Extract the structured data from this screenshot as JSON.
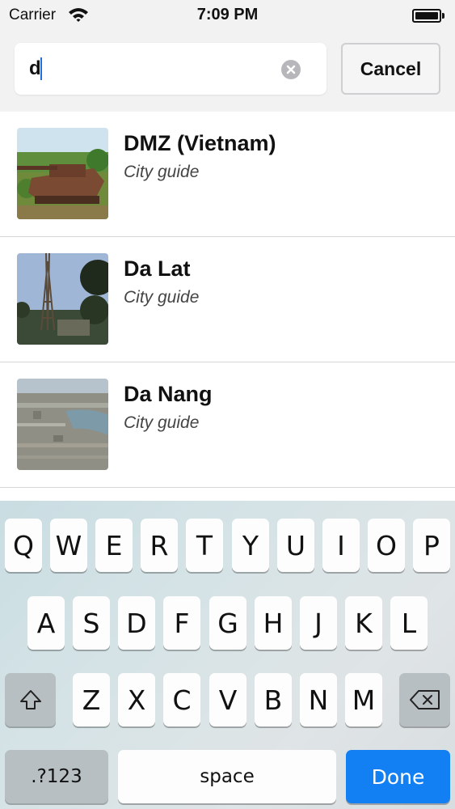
{
  "status_bar": {
    "carrier": "Carrier",
    "time": "7:09 PM",
    "wifi_icon": "wifi-icon",
    "battery_icon": "battery-icon",
    "battery_level": 1.0
  },
  "search": {
    "query": "d",
    "clear_icon": "clear-circle-icon",
    "cancel_label": "Cancel"
  },
  "results": [
    {
      "title": "DMZ (Vietnam)",
      "subtitle": "City guide",
      "thumbnail": "photo-tank"
    },
    {
      "title": "Da Lat",
      "subtitle": "City guide",
      "thumbnail": "photo-tower"
    },
    {
      "title": "Da Nang",
      "subtitle": "City guide",
      "thumbnail": "photo-city-aerial"
    }
  ],
  "keyboard": {
    "row1": [
      "Q",
      "W",
      "E",
      "R",
      "T",
      "Y",
      "U",
      "I",
      "O",
      "P"
    ],
    "row2": [
      "A",
      "S",
      "D",
      "F",
      "G",
      "H",
      "J",
      "K",
      "L"
    ],
    "row3": [
      "Z",
      "X",
      "C",
      "V",
      "B",
      "N",
      "M"
    ],
    "shift_icon": "shift-arrow-icon",
    "delete_icon": "backspace-icon",
    "numbers_label": ".?123",
    "space_label": "space",
    "done_label": "Done",
    "accent_color": "#1280f3"
  }
}
